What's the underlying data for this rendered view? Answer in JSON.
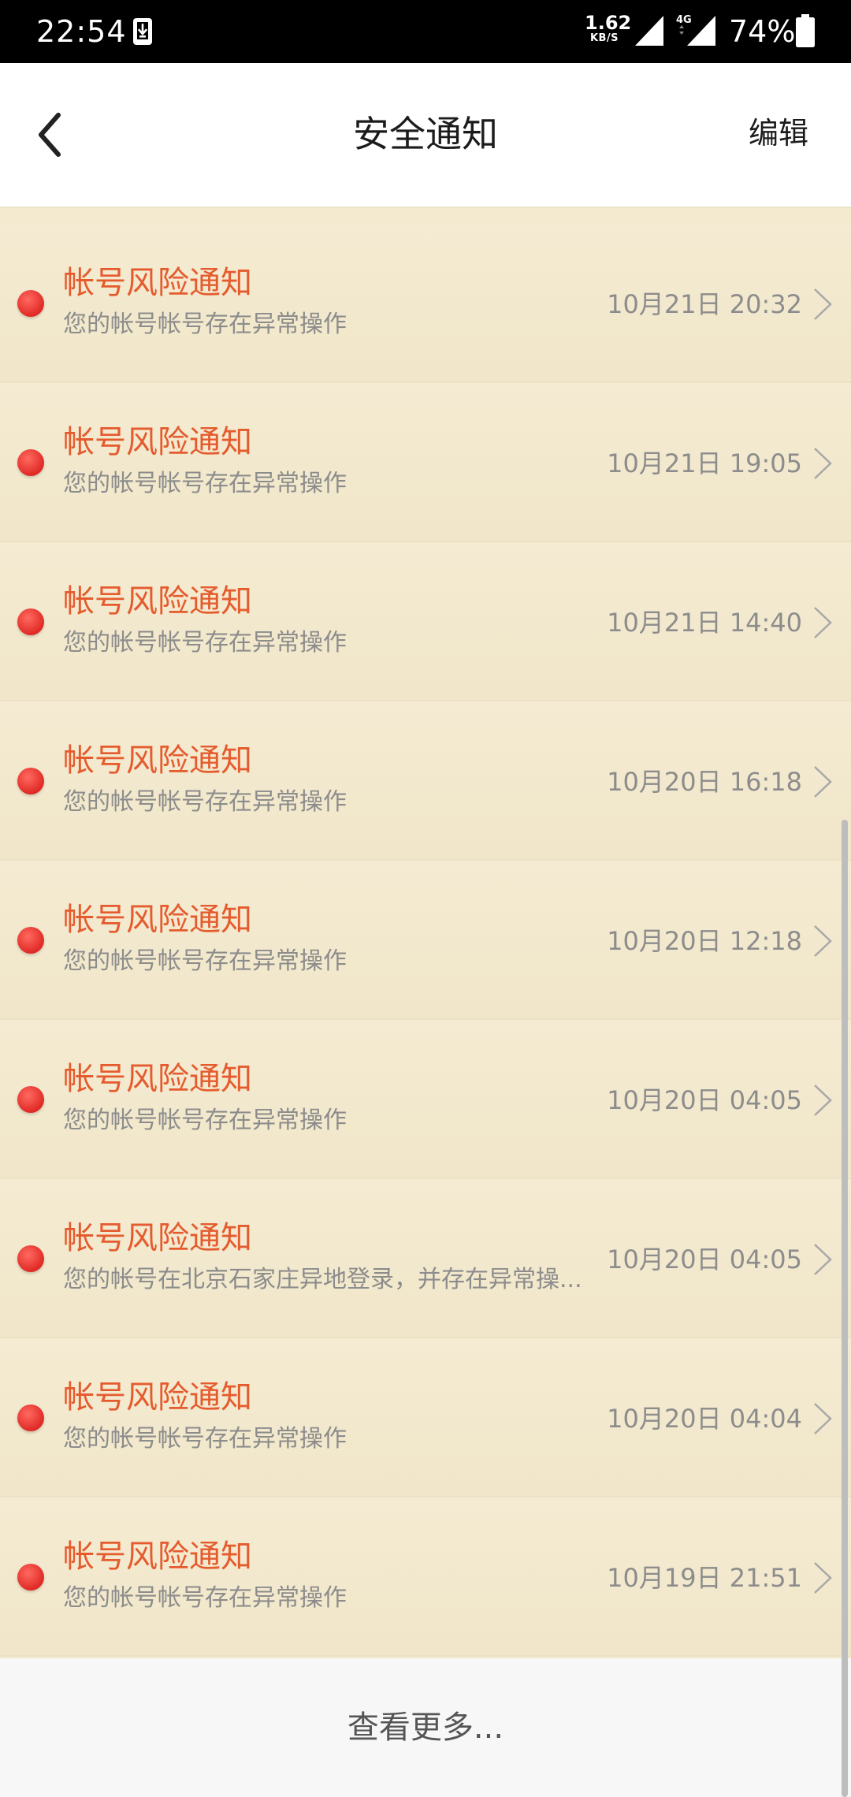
{
  "status_bar": {
    "time": "22:54",
    "net_speed_value": "1.62",
    "net_speed_unit": "KB/S",
    "network_type": "4G",
    "battery": "74%"
  },
  "header": {
    "title": "安全通知",
    "edit_label": "编辑",
    "back_icon": "chevron-left-icon"
  },
  "notifications": [
    {
      "title": "帐号风险通知",
      "desc": "您的帐号帐号存在异常操作",
      "time": "10月21日 20:32"
    },
    {
      "title": "帐号风险通知",
      "desc": "您的帐号帐号存在异常操作",
      "time": "10月21日 19:05"
    },
    {
      "title": "帐号风险通知",
      "desc": "您的帐号帐号存在异常操作",
      "time": "10月21日 14:40"
    },
    {
      "title": "帐号风险通知",
      "desc": "您的帐号帐号存在异常操作",
      "time": "10月20日 16:18"
    },
    {
      "title": "帐号风险通知",
      "desc": "您的帐号帐号存在异常操作",
      "time": "10月20日 12:18"
    },
    {
      "title": "帐号风险通知",
      "desc": "您的帐号帐号存在异常操作",
      "time": "10月20日 04:05"
    },
    {
      "title": "帐号风险通知",
      "desc": "您的帐号在北京石家庄异地登录，并存在异常操...",
      "time": "10月20日 04:05"
    },
    {
      "title": "帐号风险通知",
      "desc": "您的帐号帐号存在异常操作",
      "time": "10月20日 04:04"
    },
    {
      "title": "帐号风险通知",
      "desc": "您的帐号帐号存在异常操作",
      "time": "10月19日 21:51"
    }
  ],
  "footer": {
    "more_label": "查看更多..."
  },
  "colors": {
    "title_accent": "#e55b2e",
    "unread_dot": "#e02a26",
    "list_background": "#f3ead0"
  }
}
